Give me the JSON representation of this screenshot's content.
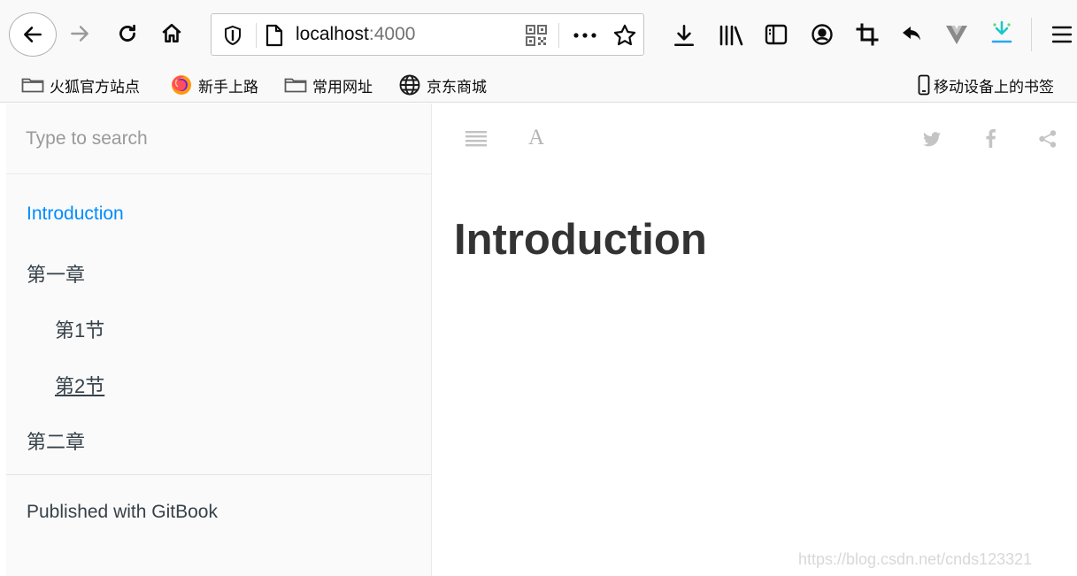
{
  "browser": {
    "url_host": "localhost",
    "url_port": ":4000"
  },
  "bookmarks": [
    {
      "label": "火狐官方站点",
      "icon": "folder-icon"
    },
    {
      "label": "新手上路",
      "icon": "firefox-icon"
    },
    {
      "label": "常用网址",
      "icon": "folder-icon"
    },
    {
      "label": "京东商城",
      "icon": "globe-icon"
    }
  ],
  "mobile_bookmarks": "移动设备上的书签",
  "sidebar": {
    "search_placeholder": "Type to search",
    "toc": [
      {
        "label": "Introduction",
        "active": true
      },
      {
        "label": "第一章"
      },
      {
        "label": "第1节"
      },
      {
        "label": "第2节"
      },
      {
        "label": "第二章"
      }
    ],
    "published": "Published with GitBook"
  },
  "header": {
    "font_button": "A"
  },
  "page": {
    "title": "Introduction"
  },
  "watermark": "https://blog.csdn.net/cnds123321",
  "colors": {
    "accent": "#008cff",
    "text": "#364149",
    "icon_gray": "#b9b9b9"
  }
}
